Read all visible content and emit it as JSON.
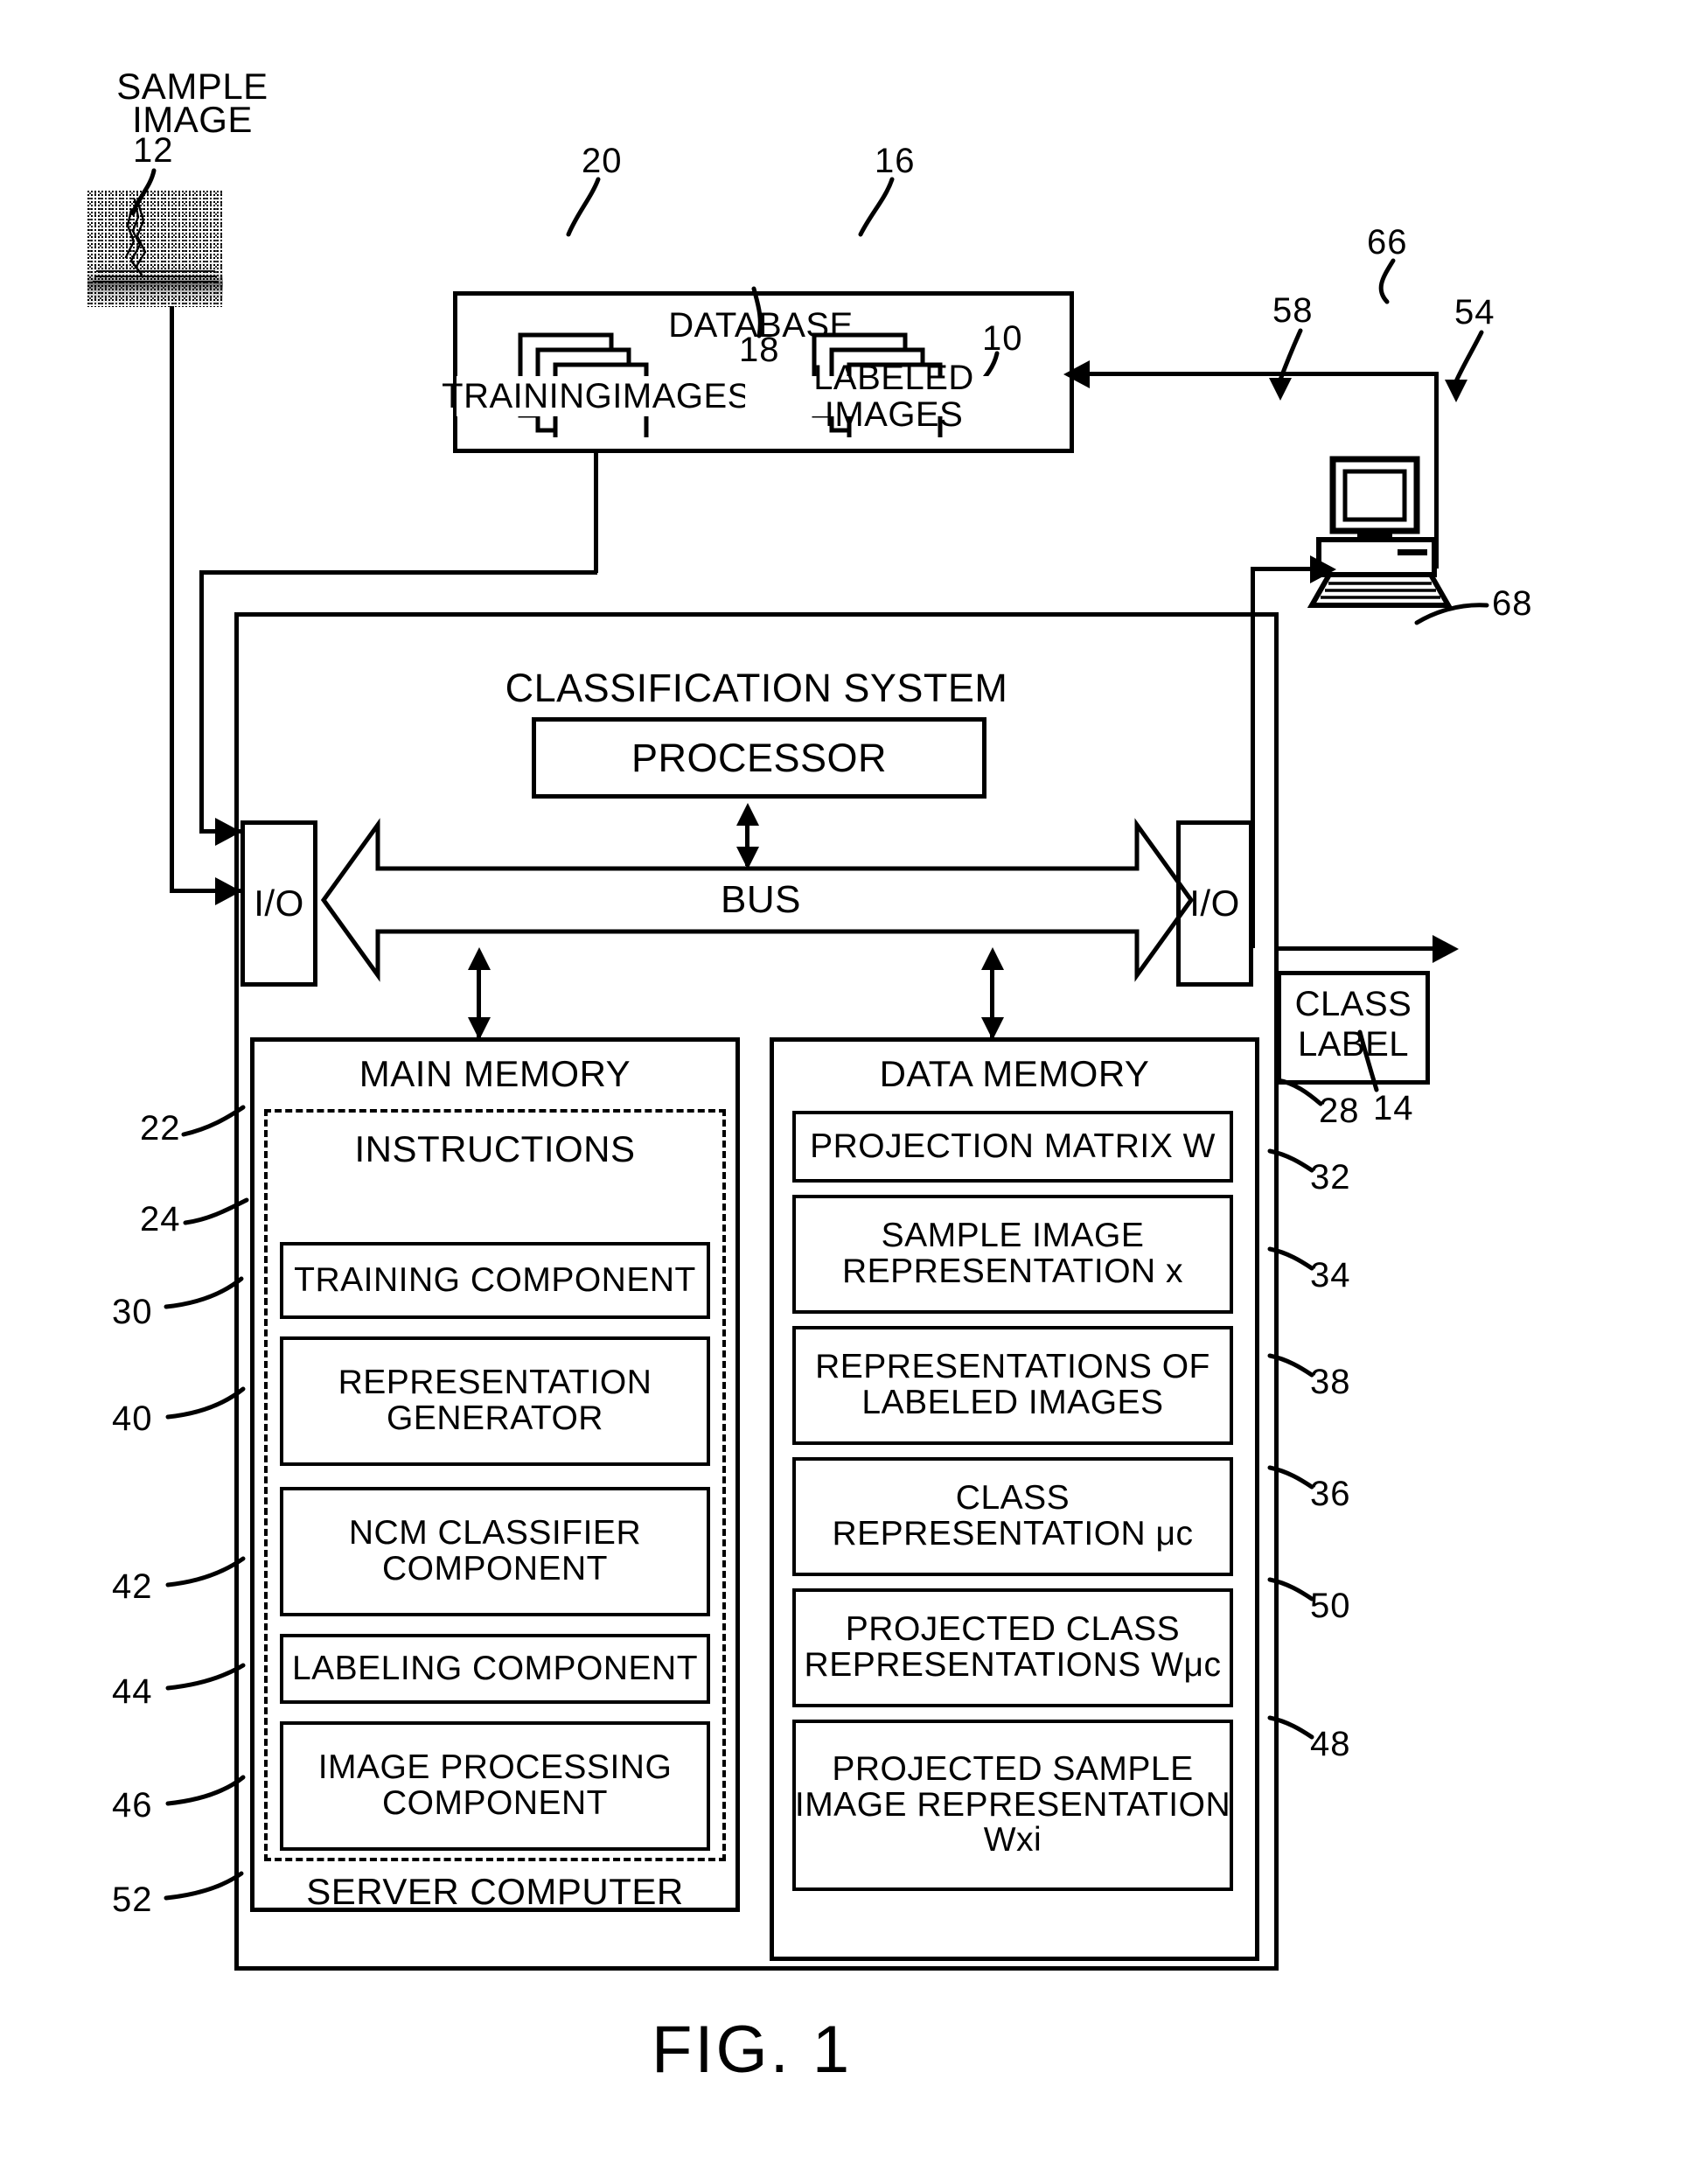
{
  "figure": {
    "caption": "FIG. 1"
  },
  "sample_image": {
    "title_line1": "SAMPLE",
    "title_line2": "IMAGE",
    "ref": "12"
  },
  "database": {
    "title": "DATABASE",
    "ref": "18",
    "training_images": {
      "label": "TRAININGIMAGES",
      "ref": "20"
    },
    "labeled_images": {
      "label": "LABELED IMAGES",
      "ref": "16"
    }
  },
  "workstation": {
    "monitor_ref": "66",
    "computer_ref": "54",
    "keyboard_ref": "68",
    "link_ref": "58"
  },
  "classification_system": {
    "title": "CLASSIFICATION SYSTEM",
    "ref": "10",
    "processor": "PROCESSOR",
    "bus": "BUS",
    "io_left": "I/O",
    "io_right": "I/O",
    "server_computer": "SERVER COMPUTER",
    "server_ref": "52"
  },
  "class_label": {
    "line1": "CLASS",
    "line2": "LABEL",
    "ref": "14"
  },
  "main_memory": {
    "title": "MAIN MEMORY",
    "ref": "22",
    "instructions_title": "INSTRUCTIONS",
    "instructions_ref": "24",
    "components": [
      {
        "label": "TRAINING COMPONENT",
        "ref": "30"
      },
      {
        "label": "REPRESENTATION\nGENERATOR",
        "ref": "40"
      },
      {
        "label": "NCM CLASSIFIER\nCOMPONENT",
        "ref": "42"
      },
      {
        "label": "LABELING COMPONENT",
        "ref": "44"
      },
      {
        "label": "IMAGE PROCESSING\nCOMPONENT",
        "ref": "46"
      }
    ]
  },
  "data_memory": {
    "title": "DATA  MEMORY",
    "ref": "28",
    "items": [
      {
        "label": "PROJECTION MATRIX W",
        "ref": "32"
      },
      {
        "label": "SAMPLE IMAGE\nREPRESENTATION x",
        "ref": "34"
      },
      {
        "label": "REPRESENTATIONS OF\nLABELED IMAGES",
        "ref": "38"
      },
      {
        "label": "CLASS\nREPRESENTATION μᴄ",
        "ref": "36"
      },
      {
        "label": "PROJECTED CLASS\nREPRESENTATIONS Wμᴄ",
        "ref": "50"
      },
      {
        "label": "PROJECTED  SAMPLE\nIMAGE REPRESENTATION\nWxi",
        "ref": "48"
      }
    ]
  },
  "colors": {
    "ink": "#000000",
    "paper": "#ffffff"
  }
}
